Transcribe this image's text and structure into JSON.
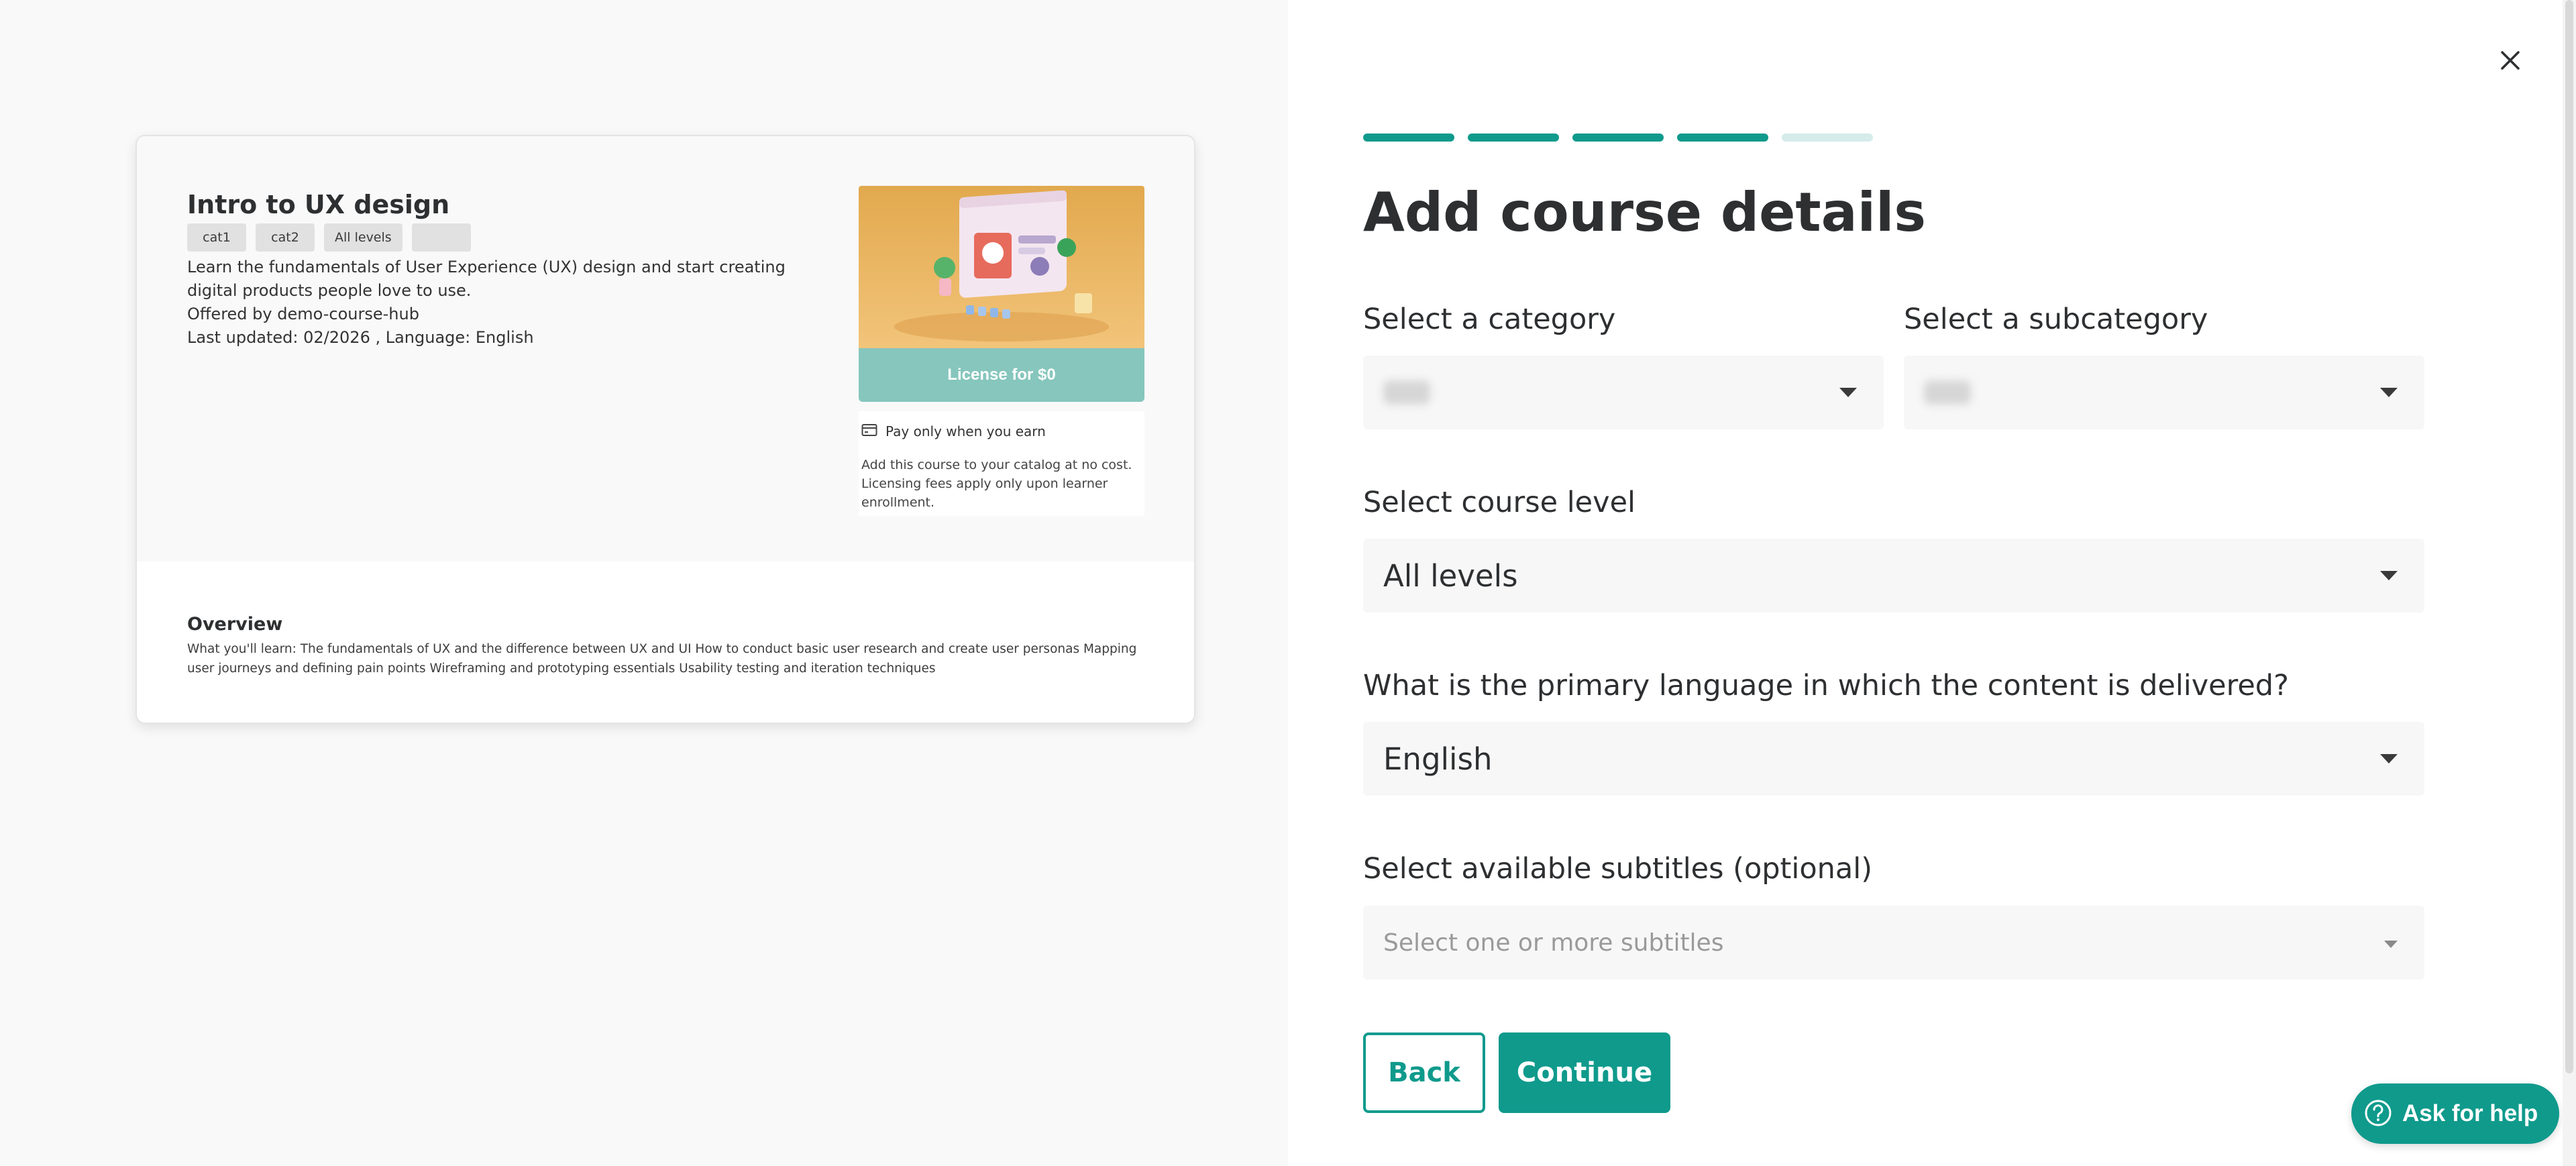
{
  "preview": {
    "title": "Intro to UX design",
    "tags": [
      "cat1",
      "cat2",
      "All levels",
      ""
    ],
    "description": "Learn the fundamentals of User Experience (UX) design and start creating digital products people love to use.",
    "offered_by": "Offered by demo-course-hub",
    "last_updated": "Last updated: 02/2026 , Language: English",
    "license_button": "License for $0",
    "pay_label": "Pay only when you earn",
    "pay_description": "Add this course to your catalog at no cost. Licensing fees apply only upon learner enrollment.",
    "overview_title": "Overview",
    "overview_text": "What you'll learn: The fundamentals of UX and the difference between UX and UI How to conduct basic user research and create user personas Mapping user journeys and defining pain points Wireframing and prototyping essentials Usability testing and iteration techniques"
  },
  "form": {
    "progress": {
      "total_steps": 5,
      "completed_steps": 4
    },
    "title": "Add course details",
    "category_label": "Select a category",
    "subcategory_label": "Select a subcategory",
    "level_label": "Select course level",
    "level_value": "All levels",
    "language_label": "What is the primary language in which the content is delivered?",
    "language_value": "English",
    "subtitles_label": "Select available subtitles (optional)",
    "subtitles_placeholder": "Select one or more subtitles",
    "back_button": "Back",
    "continue_button": "Continue"
  },
  "help_button": "Ask for help",
  "colors": {
    "accent": "#0f9a8c",
    "accent_light": "#86c6bd",
    "progress_pending": "#d5ecea"
  }
}
